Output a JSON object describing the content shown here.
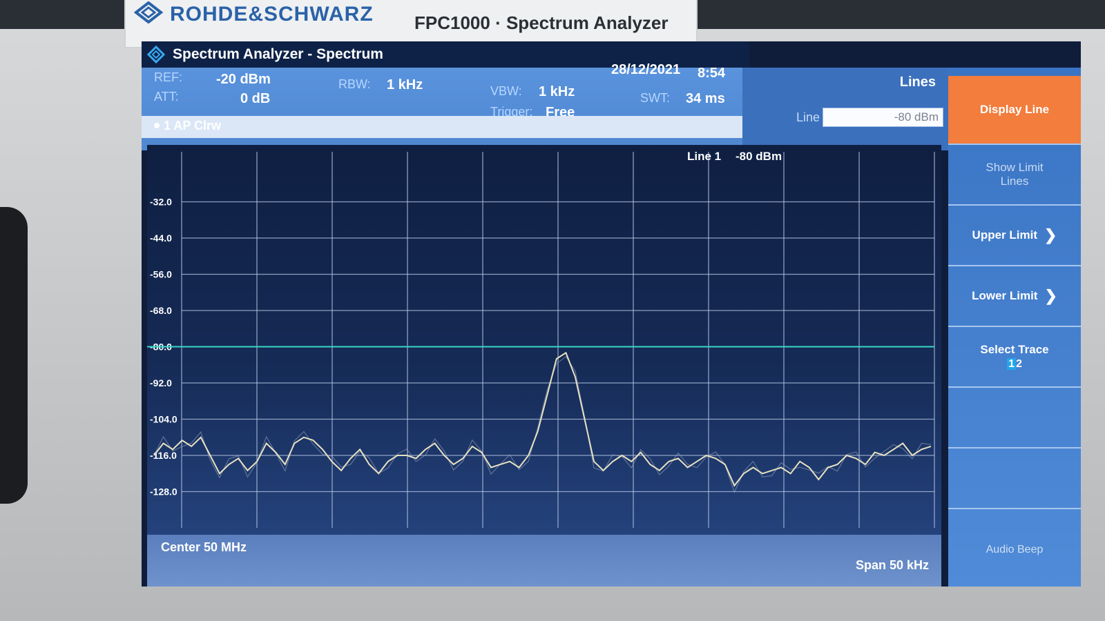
{
  "device": {
    "brand": "ROHDE&SCHWARZ",
    "model": "FPC1000 · Spectrum Analyzer"
  },
  "window": {
    "title": "Spectrum Analyzer - Spectrum",
    "date": "28/12/2021",
    "time": "8:54"
  },
  "params": {
    "ref_label": "REF:",
    "ref_value": "-20 dBm",
    "att_label": "ATT:",
    "att_value": "0 dB",
    "rbw_label": "RBW:",
    "rbw_value": "1 kHz",
    "vbw_label": "VBW:",
    "vbw_value": "1 kHz",
    "trigger_label": "Trigger:",
    "trigger_value": "Free",
    "swt_label": "SWT:",
    "swt_value": "34 ms",
    "trace_label": "1 AP Clrw"
  },
  "lines_panel": {
    "title": "Lines",
    "line_label": "Line",
    "line_value": "-80 dBm"
  },
  "plot": {
    "line_marker_name": "Line 1",
    "line_marker_value": "-80 dBm",
    "center": "Center 50 MHz",
    "span": "Span 50 kHz",
    "yticks": [
      "-32.0",
      "-44.0",
      "-56.0",
      "-68.0",
      "-80.0",
      "-92.0",
      "-104.0",
      "-116.0",
      "-128.0"
    ],
    "ymax": -20,
    "ymin": -140,
    "display_line_dbm": -80,
    "colors": {
      "trace": "#e8e2c2",
      "trace2": "#9aa6bd",
      "display_line": "#37d9c8",
      "grid": "#b8c8e6"
    },
    "trace_points": [
      -116,
      -112,
      -114,
      -111,
      -113,
      -110,
      -116,
      -122,
      -119,
      -117,
      -121,
      -118,
      -112,
      -115,
      -119,
      -112,
      -110,
      -111,
      -114,
      -118,
      -121,
      -117,
      -114,
      -119,
      -122,
      -118,
      -116,
      -116,
      -117,
      -114,
      -112,
      -116,
      -119,
      -117,
      -113,
      -115,
      -120,
      -119,
      -118,
      -120,
      -116,
      -108,
      -96,
      -84,
      -82,
      -90,
      -104,
      -118,
      -121,
      -118,
      -116,
      -118,
      -115,
      -119,
      -121,
      -118,
      -117,
      -120,
      -118,
      -116,
      -117,
      -119,
      -126,
      -122,
      -120,
      -122,
      -121,
      -120,
      -122,
      -118,
      -120,
      -124,
      -120,
      -119,
      -116,
      -117,
      -119,
      -115,
      -116,
      -114,
      -112,
      -116,
      -114,
      -113
    ]
  },
  "menu": {
    "display_line": "Display Line",
    "show_limit_lines": "Show Limit Lines",
    "upper_limit": "Upper Limit",
    "lower_limit": "Lower Limit",
    "select_trace": "Select Trace",
    "trace_1": "1",
    "trace_2": "2",
    "chevron": "❯",
    "audio_beep": "Audio Beep"
  }
}
